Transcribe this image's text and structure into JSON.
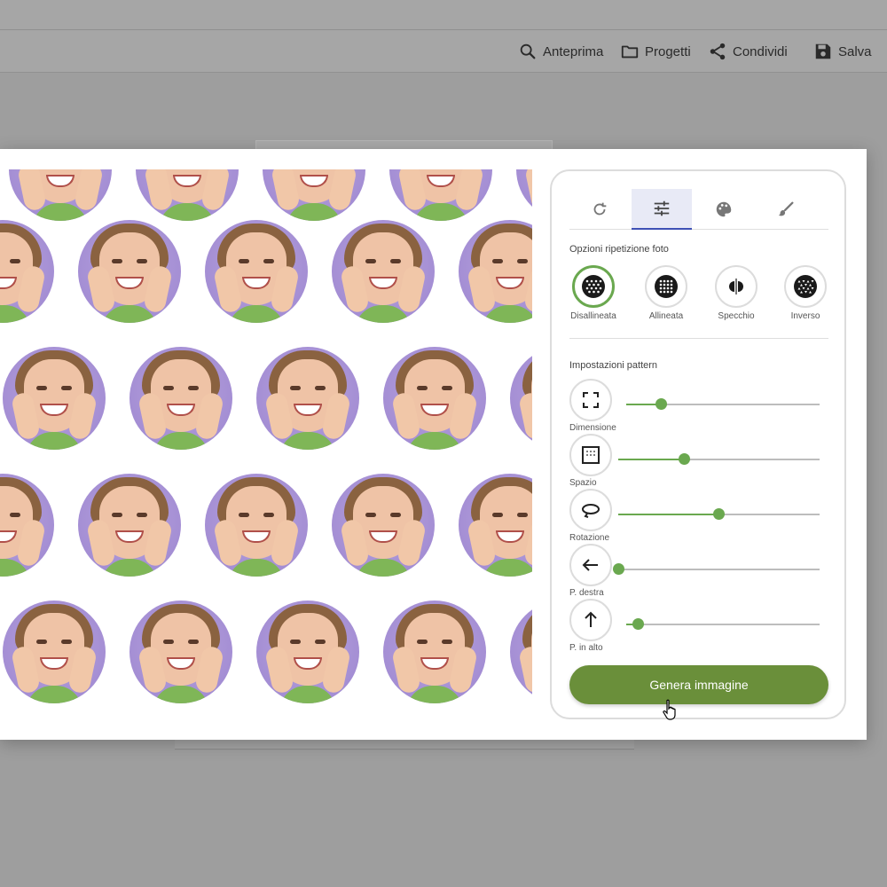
{
  "toolbar": {
    "preview_label": "Anteprima",
    "projects_label": "Progetti",
    "share_label": "Condividi",
    "save_label": "Salva"
  },
  "tabs": [
    {
      "icon": "refresh-icon"
    },
    {
      "icon": "sliders-icon"
    },
    {
      "icon": "palette-icon"
    },
    {
      "icon": "brush-icon"
    }
  ],
  "repeat_options": {
    "title": "Opzioni ripetizione foto",
    "items": [
      {
        "label": "Disallineata",
        "active": true
      },
      {
        "label": "Allineata",
        "active": false
      },
      {
        "label": "Specchio",
        "active": false
      },
      {
        "label": "Inverso",
        "active": false
      }
    ]
  },
  "pattern_settings": {
    "title": "Impostazioni pattern",
    "sliders": [
      {
        "label": "Dimensione",
        "icon": "fullscreen-icon",
        "value": 0.18
      },
      {
        "label": "Spazio",
        "icon": "grid-frame-icon",
        "value": 0.33
      },
      {
        "label": "Rotazione",
        "icon": "rotate-icon",
        "value": 0.5
      },
      {
        "label": "P. destra",
        "icon": "arrow-left-icon",
        "value": 0.0
      },
      {
        "label": "P. in alto",
        "icon": "arrow-up-icon",
        "value": 0.06
      }
    ]
  },
  "generate_button": "Genera immagine",
  "colors": {
    "accent": "#6aa84f",
    "button": "#6a8f3a",
    "active_tab": "#3f51b5",
    "photo_bg": "#a48ed4"
  }
}
